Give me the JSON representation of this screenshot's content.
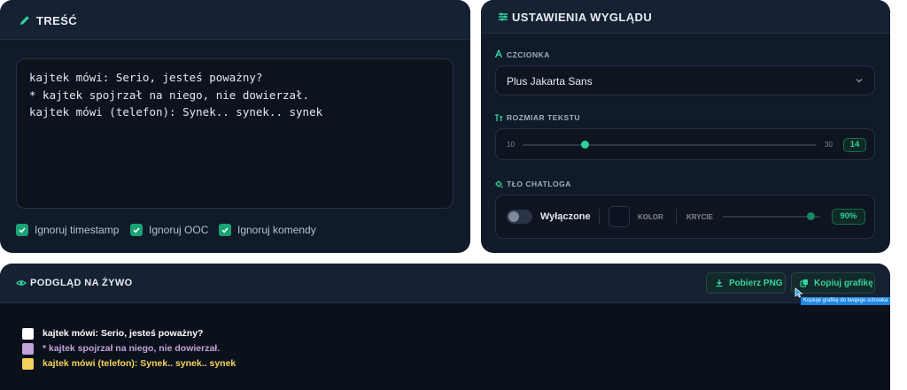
{
  "content": {
    "title": "TREŚĆ",
    "lines": [
      "kajtek mówi: Serio, jesteś poważny?",
      "* kajtek spojrzał na niego, nie dowierzał.",
      "kajtek mówi (telefon): Synek.. synek.. synek"
    ],
    "checkboxes": [
      {
        "label": "Ignoruj timestamp",
        "checked": true
      },
      {
        "label": "Ignoruj OOC",
        "checked": true
      },
      {
        "label": "Ignoruj komendy",
        "checked": true
      }
    ]
  },
  "settings": {
    "title": "USTAWIENIA WYGLĄDU",
    "font": {
      "label": "CZCIONKA",
      "value": "Plus Jakarta Sans"
    },
    "text_size": {
      "label": "ROZMIAR TEKSTU",
      "min": "10",
      "max": "30",
      "value": "14"
    },
    "background": {
      "label": "TŁO CHATLOGA",
      "toggle_label": "Wyłączone",
      "enabled": false,
      "color_label": "KOLOR",
      "opacity_label": "KRYCIE",
      "opacity_value": "90%",
      "opacity_fraction": 0.9
    },
    "accent_color": "#2fd39a"
  },
  "preview": {
    "title": "PODGLĄD NA ŻYWO",
    "download_button": "Pobierz PNG",
    "copy_button": "Kopiuj grafikę",
    "tooltip": "Kopiuje grafikę do twojego schowka",
    "lines": [
      {
        "text": "kajtek mówi: Serio, jesteś poważny?",
        "color": "#ffffff"
      },
      {
        "text": "* kajtek spojrzał na niego, nie dowierzał.",
        "color": "#c2a2da"
      },
      {
        "text": "kajtek mówi (telefon): Synek.. synek.. synek",
        "color": "#f5d35a"
      }
    ]
  }
}
